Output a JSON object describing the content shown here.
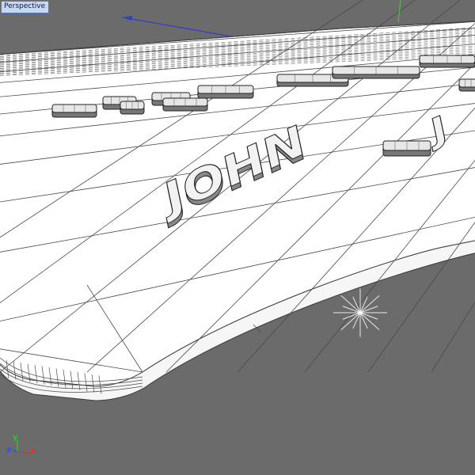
{
  "viewport": {
    "label": "Perspective"
  },
  "scene": {
    "name_text": "JOHN",
    "name_text_prefix": "J",
    "background_color": "#6b6b6b",
    "wire_color": "#4a4a4a",
    "plate_color": "#ffffff",
    "x_axis_color": "#2f3fc8",
    "y_axis_color": "#3cc83c",
    "light_color": "#ffffff",
    "icons": [
      "viewport-label",
      "axis-gizmo-icon",
      "omni-light-icon",
      "target-axis-icon"
    ]
  },
  "axis_gizmo": {
    "x_label": "x",
    "y_label": "y",
    "z_label": "z",
    "x_color": "#e03030",
    "y_color": "#30c030",
    "z_color": "#3050e0"
  }
}
